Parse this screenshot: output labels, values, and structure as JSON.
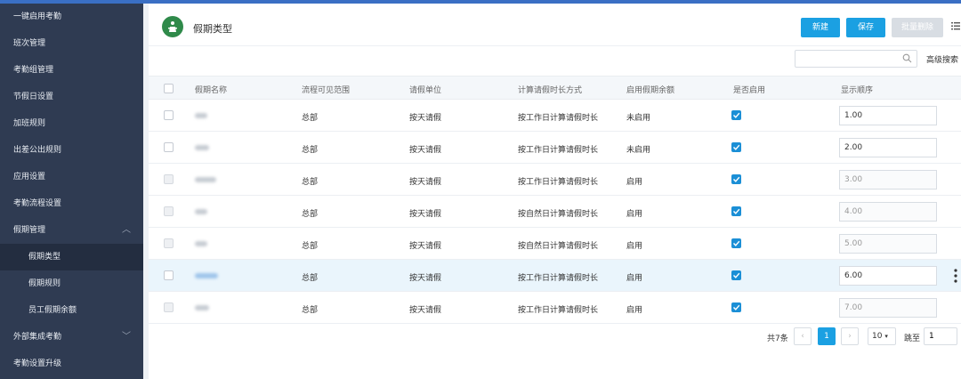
{
  "sidebar": {
    "items": [
      {
        "label": "一键启用考勤"
      },
      {
        "label": "班次管理"
      },
      {
        "label": "考勤组管理"
      },
      {
        "label": "节假日设置"
      },
      {
        "label": "加班规则"
      },
      {
        "label": "出差公出规则"
      },
      {
        "label": "应用设置"
      },
      {
        "label": "考勤流程设置"
      },
      {
        "label": "假期管理",
        "expanded": true
      },
      {
        "label": "假期类型",
        "active": true
      },
      {
        "label": "假期规则"
      },
      {
        "label": "员工假期余额"
      },
      {
        "label": "外部集成考勤",
        "expanded": false
      },
      {
        "label": "考勤设置升级"
      }
    ]
  },
  "header": {
    "title": "假期类型",
    "new_label": "新建",
    "save_label": "保存",
    "batch_label": "批量删除"
  },
  "search": {
    "placeholder": "",
    "advanced_label": "高级搜索"
  },
  "table": {
    "columns": [
      "假期名称",
      "流程可见范围",
      "请假单位",
      "计算请假时长方式",
      "启用假期余额",
      "是否启用",
      "显示顺序"
    ],
    "rows": [
      {
        "scope": "总部",
        "unit": "按天请假",
        "method": "按工作日计算请假时长",
        "balance": "未启用",
        "enabled": true,
        "order": "1.00"
      },
      {
        "scope": "总部",
        "unit": "按天请假",
        "method": "按工作日计算请假时长",
        "balance": "未启用",
        "enabled": true,
        "order": "2.00"
      },
      {
        "scope": "总部",
        "unit": "按天请假",
        "method": "按工作日计算请假时长",
        "balance": "启用",
        "enabled": true,
        "order": "3.00"
      },
      {
        "scope": "总部",
        "unit": "按天请假",
        "method": "按自然日计算请假时长",
        "balance": "启用",
        "enabled": true,
        "order": "4.00"
      },
      {
        "scope": "总部",
        "unit": "按天请假",
        "method": "按自然日计算请假时长",
        "balance": "启用",
        "enabled": true,
        "order": "5.00"
      },
      {
        "scope": "总部",
        "unit": "按天请假",
        "method": "按工作日计算请假时长",
        "balance": "启用",
        "enabled": true,
        "order": "6.00"
      },
      {
        "scope": "总部",
        "unit": "按天请假",
        "method": "按工作日计算请假时长",
        "balance": "启用",
        "enabled": true,
        "order": "7.00"
      }
    ]
  },
  "pagination": {
    "total_label": "共7条",
    "current_page": "1",
    "page_size": "10",
    "goto_label": "跳至",
    "goto_value": "1"
  },
  "colors": {
    "sidebar_bg": "#2f3b52",
    "accent": "#1ba0e2",
    "logo": "#2f8a4a"
  }
}
